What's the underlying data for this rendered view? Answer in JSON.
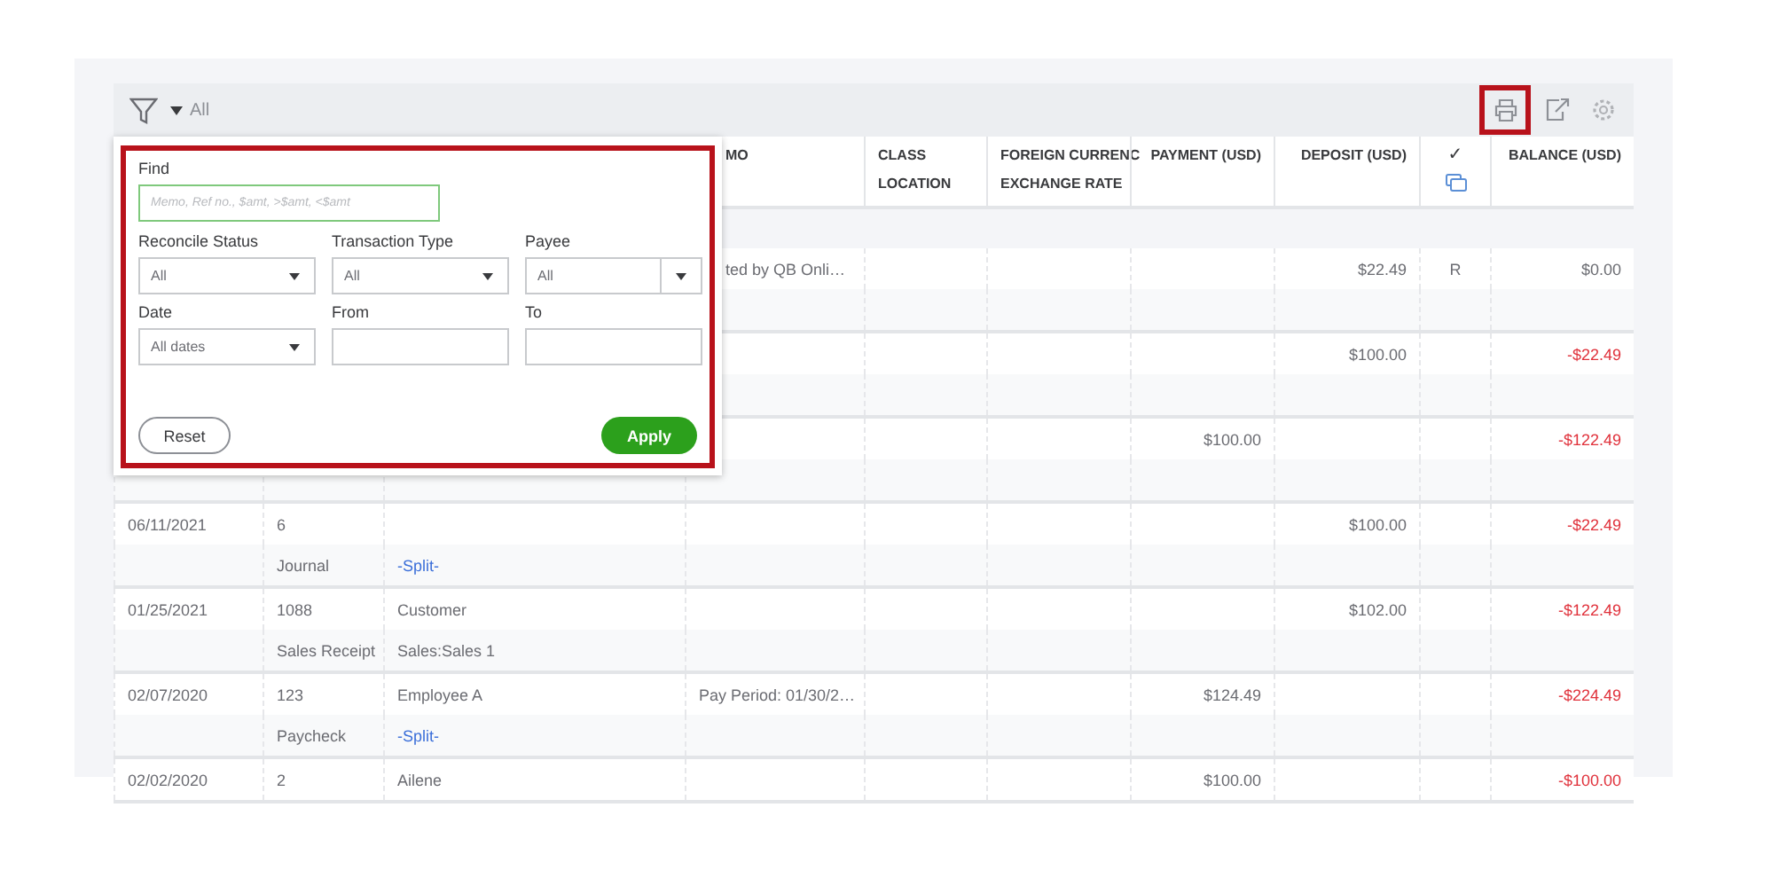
{
  "toolbar": {
    "filter_label": "All",
    "print_highlighted": true
  },
  "filter_panel": {
    "find_label": "Find",
    "find_placeholder": "Memo, Ref no., $amt, >$amt, <$amt",
    "fields": [
      {
        "label": "Reconcile Status",
        "value": "All",
        "kind": "select"
      },
      {
        "label": "Transaction Type",
        "value": "All",
        "kind": "select"
      },
      {
        "label": "Payee",
        "value": "All",
        "kind": "combo"
      },
      {
        "label": "Date",
        "value": "All dates",
        "kind": "select"
      },
      {
        "label": "From",
        "kind": "text"
      },
      {
        "label": "To",
        "kind": "text"
      }
    ],
    "reset": "Reset",
    "apply": "Apply"
  },
  "columns": [
    {
      "kind": "blank"
    },
    {
      "kind": "blank"
    },
    {
      "kind": "blank"
    },
    {
      "lines": [
        "MO"
      ],
      "kind": "text"
    },
    {
      "lines": [
        "CLASS",
        "LOCATION"
      ],
      "kind": "text"
    },
    {
      "lines": [
        "FOREIGN CURRENC",
        "EXCHANGE RATE"
      ],
      "kind": "text"
    },
    {
      "lines": [
        "PAYMENT (USD)"
      ],
      "kind": "text"
    },
    {
      "lines": [
        "DEPOSIT (USD)"
      ],
      "kind": "text"
    },
    {
      "lines": [
        "✓"
      ],
      "kind": "check"
    },
    {
      "lines": [
        "BALANCE (USD)"
      ],
      "kind": "text"
    }
  ],
  "rows": [
    {
      "memo": "ted by QB Onli…",
      "deposit": "$22.49",
      "check": "R",
      "balance": "$0.00",
      "negative": false,
      "kind": "double"
    },
    {
      "deposit": "$100.00",
      "balance": "-$22.49",
      "negative": true,
      "kind": "double"
    },
    {
      "payment": "$100.00",
      "balance": "-$122.49",
      "negative": true,
      "kind": "double"
    },
    {
      "date": "06/11/2021",
      "ref": "6",
      "type": "Journal",
      "account": "-Split-",
      "account_link": true,
      "deposit": "$100.00",
      "balance": "-$22.49",
      "negative": true,
      "kind": "double"
    },
    {
      "date": "01/25/2021",
      "ref": "1088",
      "payee": "Customer",
      "type": "Sales Receipt",
      "account": "Sales:Sales 1",
      "account_link": false,
      "deposit": "$102.00",
      "balance": "-$122.49",
      "negative": true,
      "kind": "double"
    },
    {
      "date": "02/07/2020",
      "ref": "123",
      "payee": "Employee A",
      "memo": "Pay Period: 01/30/2…",
      "type": "Paycheck",
      "account": "-Split-",
      "account_link": true,
      "payment": "$124.49",
      "balance": "-$224.49",
      "negative": true,
      "kind": "double"
    },
    {
      "date": "02/02/2020",
      "ref": "2",
      "payee": "Ailene",
      "payment": "$100.00",
      "balance": "-$100.00",
      "negative": true,
      "kind": "single"
    }
  ]
}
